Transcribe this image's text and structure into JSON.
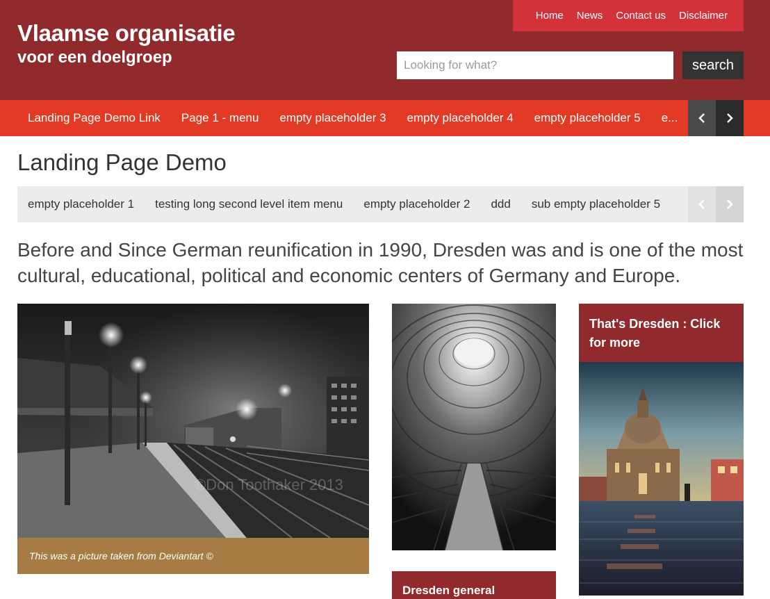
{
  "header": {
    "logo_title": "Vlaamse organisatie",
    "logo_subtitle": "voor een doelgroep",
    "topnav": [
      "Home",
      "News",
      "Contact us",
      "Disclaimer"
    ],
    "search": {
      "placeholder": "Looking for what?",
      "value": "",
      "button_label": "search"
    }
  },
  "mainnav": {
    "items": [
      "Landing Page Demo Link",
      "Page 1 - menu",
      "empty placeholder 3",
      "empty placeholder 4",
      "empty placeholder 5",
      "e..."
    ],
    "prev_icon": "chevron-left-icon",
    "next_icon": "chevron-right-icon"
  },
  "page": {
    "title": "Landing Page Demo",
    "subnav": [
      "empty placeholder 1",
      "testing long second level item menu",
      "empty placeholder 2",
      "ddd",
      "sub empty placeholder 5"
    ],
    "intro": "Before and Since German reunification in 1990, Dresden was and is one of the most cultural, educational, political and economic centers of Germany and Europe."
  },
  "cards": {
    "train": {
      "watermark": "©Don Toothaker 2013",
      "caption": "This was a picture taken from Deviantart ©"
    },
    "tower": {},
    "dresden_general": {
      "title": "Dresden general"
    },
    "dresden": {
      "title": "That's Dresden : Click for more"
    }
  },
  "colors": {
    "header_bg": "#902a2d",
    "topnav_bg": "#d2333a",
    "mainnav_bg": "#e23a24",
    "caption_bg": "#a67c44",
    "search_button_bg": "#333333"
  }
}
